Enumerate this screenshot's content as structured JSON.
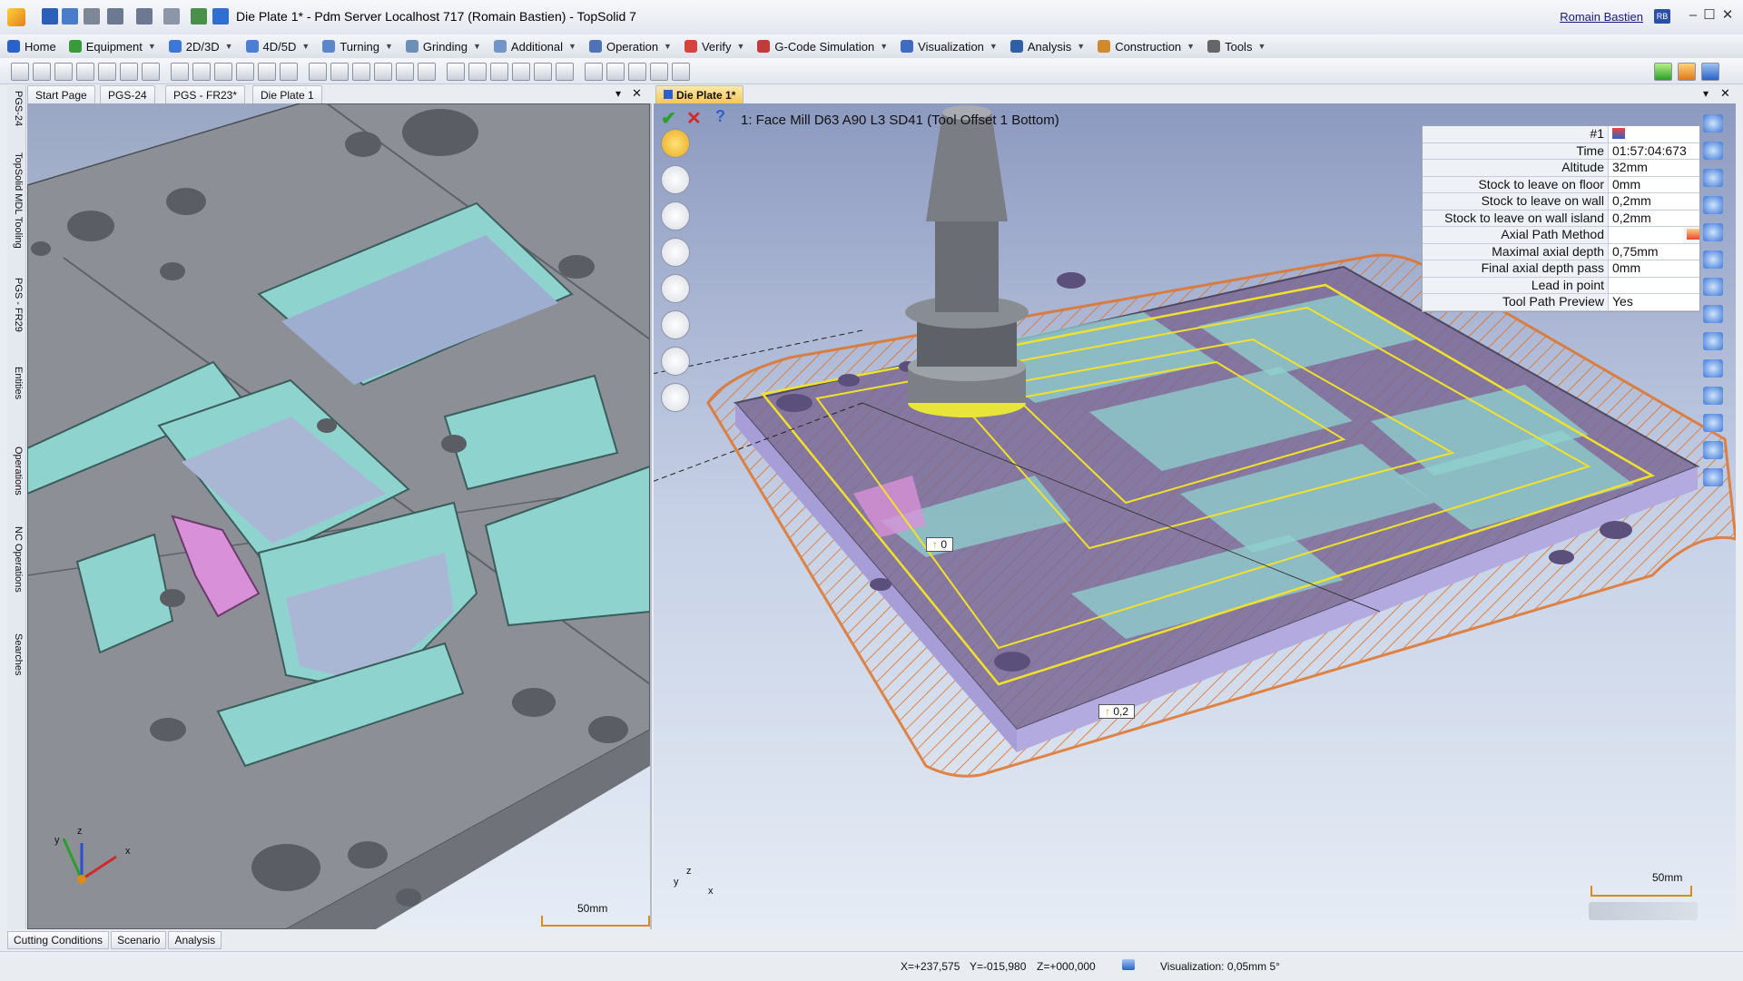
{
  "window": {
    "title": "Die Plate 1* - Pdm Server Localhost 717 (Romain Bastien) - TopSolid 7",
    "user": "Romain Bastien",
    "user_initials": "RB"
  },
  "menu": [
    {
      "label": "Home",
      "color": "#2a62c9"
    },
    {
      "label": "Equipment",
      "color": "#3a9a3a"
    },
    {
      "label": "2D/3D",
      "color": "#3d78d8"
    },
    {
      "label": "4D/5D",
      "color": "#4a7fd4"
    },
    {
      "label": "Turning",
      "color": "#5b86c9"
    },
    {
      "label": "Grinding",
      "color": "#6c8fb8"
    },
    {
      "label": "Additional",
      "color": "#7294c6"
    },
    {
      "label": "Operation",
      "color": "#4f73b7"
    },
    {
      "label": "Verify",
      "color": "#d4443c"
    },
    {
      "label": "G-Code Simulation",
      "color": "#c33a3a"
    },
    {
      "label": "Visualization",
      "color": "#3f6cc2"
    },
    {
      "label": "Analysis",
      "color": "#2f5fa6"
    },
    {
      "label": "Construction",
      "color": "#d08a2c"
    },
    {
      "label": "Tools",
      "color": "#666666"
    }
  ],
  "left_doc_tabs": [
    "Start Page",
    "PGS-24",
    "PGS - FR23*",
    "Die Plate 1"
  ],
  "right_doc_tab": "Die Plate 1*",
  "side_tabs": [
    "PGS-24",
    "TopSolid MDL Tooling",
    "PGS - FR29",
    "Entities",
    "Operations",
    "NC Operations",
    "Searches"
  ],
  "operation": {
    "title": "1: Face Mill D63 A90 L3 SD41 (Tool Offset 1 Bottom)"
  },
  "properties": {
    "header": "#1",
    "rows": [
      {
        "key": "Time",
        "value": "01:57:04:673"
      },
      {
        "key": "Altitude",
        "value": "32mm"
      },
      {
        "key": "Stock to leave on floor",
        "value": "0mm"
      },
      {
        "key": "Stock to leave on wall",
        "value": "0,2mm"
      },
      {
        "key": "Stock to leave on wall island",
        "value": "0,2mm"
      },
      {
        "key": "Axial Path Method",
        "value": ""
      },
      {
        "key": "Maximal axial depth",
        "value": "0,75mm"
      },
      {
        "key": "Final axial depth pass",
        "value": "0mm"
      },
      {
        "key": "Lead in point",
        "value": ""
      },
      {
        "key": "Tool Path Preview",
        "value": "Yes"
      }
    ]
  },
  "labels": {
    "depth_zero": "0",
    "stock_tag": "0,2",
    "scale_left": "50mm",
    "scale_right": "50mm",
    "axis_x": "x",
    "axis_y": "y",
    "axis_z": "z"
  },
  "bottom_tabs": [
    "Cutting Conditions",
    "Scenario",
    "Analysis"
  ],
  "status": {
    "x": "X=+237,575",
    "y": "Y=-015,980",
    "z": "Z=+000,000",
    "visualization": "Visualization: 0,05mm 5°"
  },
  "colors": {
    "plate": "#8c8f96",
    "pocket_cyan": "#8fd3cf",
    "highlight_pink": "#d891d8",
    "toolpath": "#f2e12a",
    "stock_hatch": "#e0742a",
    "active_tab": "#f6c453"
  }
}
